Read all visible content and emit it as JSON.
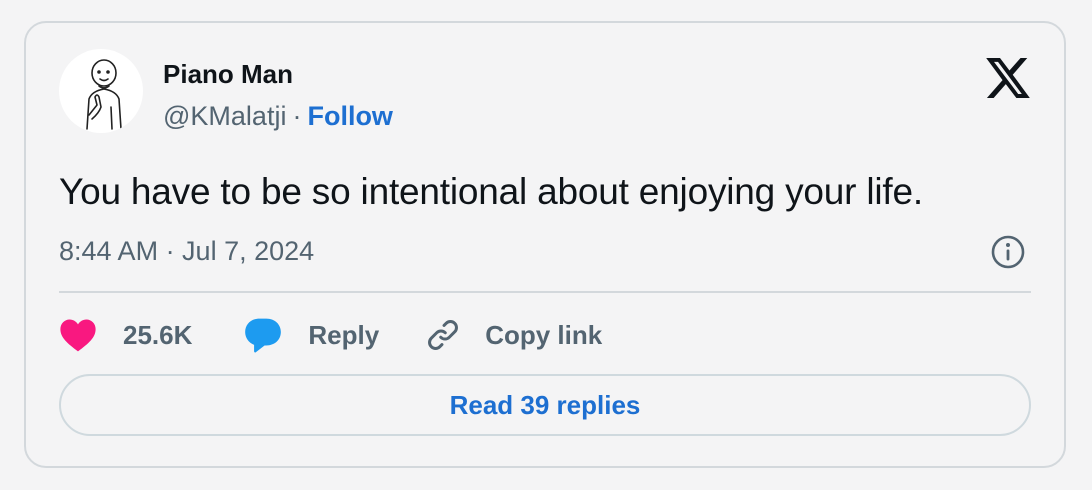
{
  "author": {
    "name": "Piano Man",
    "handle": "@KMalatji",
    "separator": "·",
    "follow_label": "Follow"
  },
  "tweet": {
    "text": "You have to be so intentional about enjoying your life.",
    "timestamp": "8:44 AM · Jul 7, 2024"
  },
  "actions": {
    "like_count": "25.6K",
    "reply_label": "Reply",
    "copy_link_label": "Copy link"
  },
  "read_replies_label": "Read 39 replies",
  "icons": {
    "logo": "x-logo-icon",
    "info": "info-icon",
    "like": "heart-icon",
    "reply": "speech-bubble-icon",
    "copy": "link-icon"
  },
  "colors": {
    "accent": "#1d6fd1",
    "like": "#f91880",
    "reply": "#1d9bf0",
    "muted_text": "#536471",
    "border": "#d3d8dc",
    "background": "#f4f4f5"
  }
}
